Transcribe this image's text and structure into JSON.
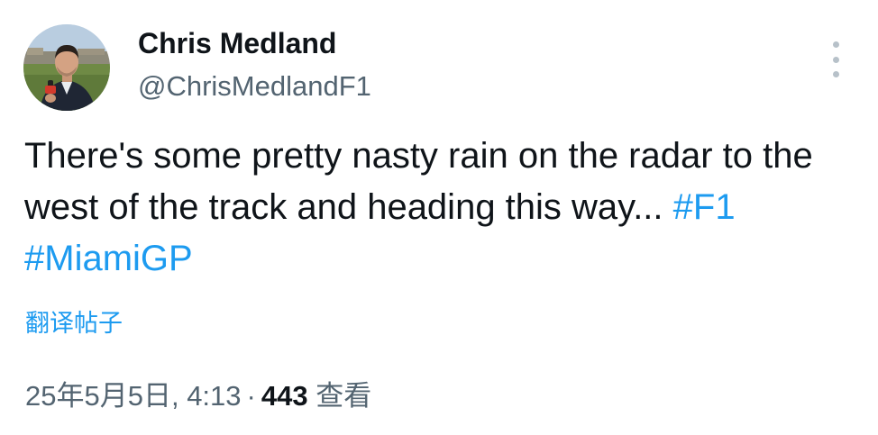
{
  "author": {
    "display_name": "Chris Medland",
    "handle": "@ChrisMedlandF1"
  },
  "tweet": {
    "text_part": "There's some pretty nasty rain on the radar to the west of the track and heading this way...",
    "hashtags": [
      "#F1",
      "#MiamiGP"
    ]
  },
  "translate_label": "翻译帖子",
  "meta": {
    "timestamp": "25年5月5日, 4:13",
    "separator": "·",
    "views_count": "443",
    "views_label": "查看"
  },
  "icons": {
    "more": "more-vertical-icon",
    "avatar": "profile-photo"
  },
  "colors": {
    "link": "#1d9bf0",
    "secondary_text": "#536471",
    "primary_text": "#0f1419"
  }
}
